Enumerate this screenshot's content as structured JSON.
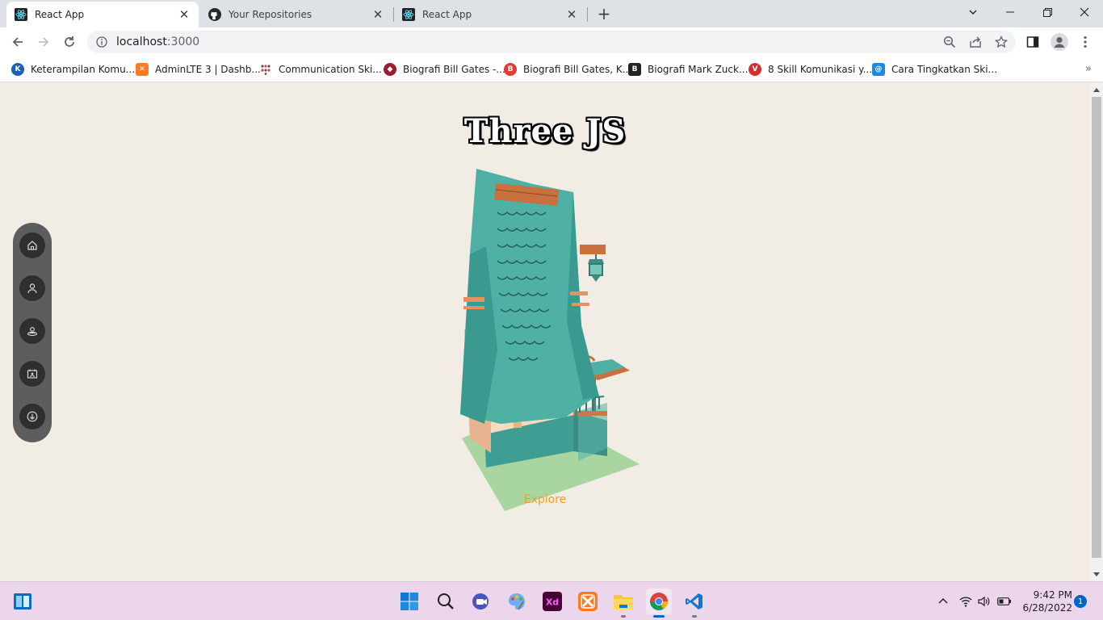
{
  "browser": {
    "tabs": [
      {
        "title": "React App",
        "active": true,
        "favicon": "react-icon"
      },
      {
        "title": "Your Repositories",
        "active": false,
        "favicon": "github-icon"
      },
      {
        "title": "React App",
        "active": false,
        "favicon": "react-icon"
      }
    ],
    "new_tab_label": "+",
    "address": {
      "host": "localhost",
      "port": ":3000"
    },
    "bookmarks": [
      {
        "label": "Keterampilan Komu...",
        "icon": "kompas-icon",
        "color": "#1a5fb4"
      },
      {
        "label": "AdminLTE 3 | Dashb...",
        "icon": "xampp-icon",
        "color": "#fb7a24"
      },
      {
        "label": "Communication Ski...",
        "icon": "dots-icon",
        "color": "#e04040"
      },
      {
        "label": "Biografi Bill Gates -...",
        "icon": "diamond-icon",
        "color": "#9b1b30"
      },
      {
        "label": "Biografi Bill Gates, K...",
        "icon": "b-red-icon",
        "color": "#e53935"
      },
      {
        "label": "Biografi Mark Zuck...",
        "icon": "b-black-icon",
        "color": "#222222"
      },
      {
        "label": "8 Skill Komunikasi y...",
        "icon": "v-red-icon",
        "color": "#d32f2f"
      },
      {
        "label": "Cara Tingkatkan Ski...",
        "icon": "swirl-icon",
        "color": "#1e88e5"
      }
    ],
    "bookmarks_more": "»"
  },
  "page": {
    "title": "Three JS",
    "explore_label": "Explore",
    "nav": [
      "home-icon",
      "user-icon",
      "skills-icon",
      "projects-icon",
      "download-icon"
    ],
    "colors": {
      "background": "#f1ece4",
      "nav_bg": "#5d5d5d",
      "nav_item": "#2f2f2f",
      "explore": "#f0a020",
      "roof": "#4fb0a4",
      "wall": "#f3dcc0",
      "ground": "#a8d5a0"
    }
  },
  "taskbar": {
    "time": "9:42 PM",
    "date": "6/28/2022",
    "notifications": "1",
    "apps": [
      "windows-start-icon",
      "search-icon",
      "chat-icon",
      "paint-icon",
      "adobe-xd-icon",
      "xampp-icon",
      "file-explorer-icon",
      "chrome-icon",
      "vscode-icon"
    ]
  }
}
